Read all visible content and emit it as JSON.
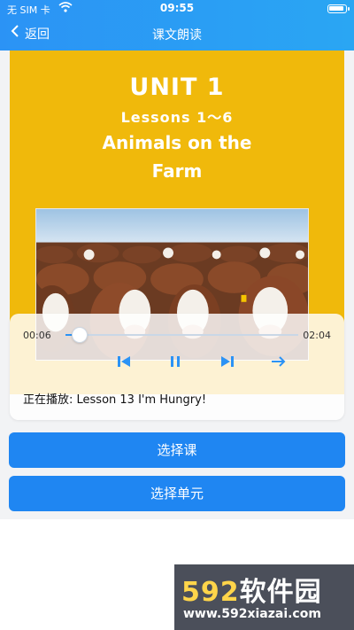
{
  "status_bar": {
    "carrier": "无 SIM 卡",
    "time": "09:55"
  },
  "nav": {
    "back_label": "返回",
    "title": "课文朗读"
  },
  "book": {
    "unit": "UNIT 1",
    "lessons": "Lessons 1～6",
    "topic_line1": "Animals on the",
    "topic_line2": "Farm"
  },
  "player": {
    "current_time": "00:06",
    "duration": "02:04",
    "progress": 0.05,
    "now_playing": "正在播放: Lesson 13 I'm Hungry!"
  },
  "buttons": {
    "select_lesson": "选择课",
    "select_unit": "选择单元"
  },
  "watermark": {
    "brand_num": "592",
    "brand_text": "软件园",
    "url": "www.592xiazai.com"
  },
  "colors": {
    "header_blue": "#2b93f5",
    "button_blue": "#1f86f2",
    "cover_yellow": "#f0b90b"
  }
}
